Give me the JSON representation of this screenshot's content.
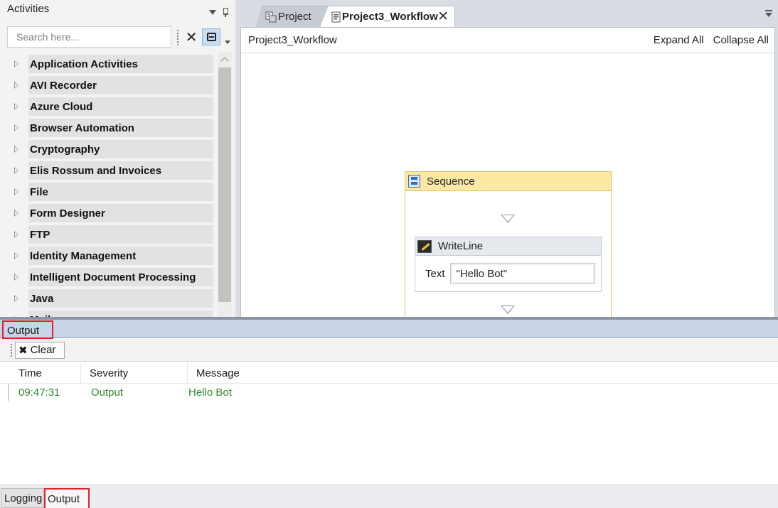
{
  "activities_panel": {
    "title": "Activities",
    "search_placeholder": "Search here...",
    "categories": [
      "Application Activities",
      "AVI Recorder",
      "Azure Cloud",
      "Browser Automation",
      "Cryptography",
      "Elis Rossum and Invoices",
      "File",
      "Form Designer",
      "FTP",
      "Identity Management",
      "Intelligent Document Processing",
      "Java",
      "Mail"
    ]
  },
  "document_tabs": [
    {
      "label": "Project",
      "active": false
    },
    {
      "label": "Project3_Workflow",
      "active": true
    }
  ],
  "designer": {
    "breadcrumb": "Project3_Workflow",
    "expand_all": "Expand All",
    "collapse_all": "Collapse All",
    "sequence": {
      "title": "Sequence",
      "writeline": {
        "title": "WriteLine",
        "field_label": "Text",
        "field_value": "\"Hello Bot\""
      }
    }
  },
  "output_panel": {
    "title": "Output",
    "clear_label": "Clear",
    "columns": [
      "Time",
      "Severity",
      "Message"
    ],
    "rows": [
      {
        "time": "09:47:31",
        "severity": "Output",
        "message": "Hello Bot"
      }
    ]
  },
  "bottom_tabs": [
    "Logging",
    "Output"
  ],
  "colors": {
    "highlight_border": "#d9252b",
    "sequence_header": "#fde9a4",
    "output_text": "#2d8a2d",
    "panel_titlebar": "#c9d5e6"
  }
}
